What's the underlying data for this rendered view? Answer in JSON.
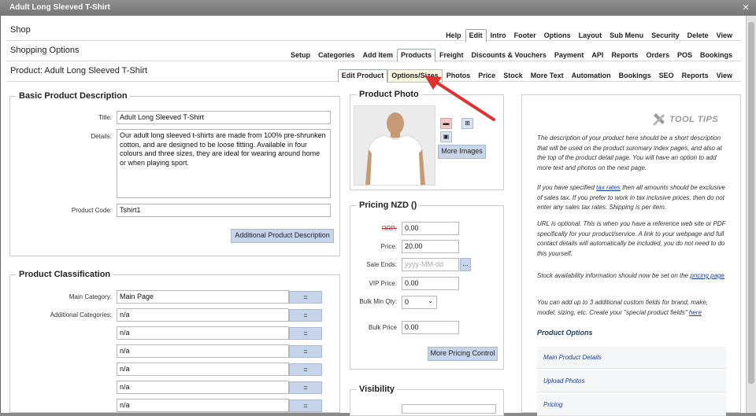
{
  "window": {
    "title": "Adult Long Sleeved T-Shirt"
  },
  "bars": {
    "shop": {
      "label": "Shop",
      "menu": [
        "Help",
        "Edit",
        "Intro",
        "Footer",
        "Options",
        "Layout",
        "Sub Menu",
        "Security",
        "Delete",
        "View"
      ]
    },
    "shopping": {
      "label": "Shopping Options",
      "menu": [
        "Setup",
        "Categories",
        "Add Item",
        "Products",
        "Freight",
        "Discounts & Vouchers",
        "Payment",
        "API",
        "Reports",
        "Orders",
        "POS",
        "Bookings"
      ]
    },
    "product": {
      "label": "Product: Adult Long Sleeved T-Shirt",
      "menu": [
        "Edit Product",
        "Options/Sizes",
        "Photos",
        "Price",
        "Stock",
        "More Text",
        "Automation",
        "Bookings",
        "SEO",
        "Reports",
        "View"
      ]
    }
  },
  "basic": {
    "legend": "Basic Product Description",
    "title_label": "Title:",
    "title_value": "Adult Long Sleeved T-Shirt",
    "details_label": "Details:",
    "details_value": "Our adult long sleeved t-shirts are made from 100% pre-shrunken cotton, and are designed to be loose fitting. Available in four colours and three sizes, they are ideal for wearing around home or when playing sport.",
    "code_label": "Product Code:",
    "code_value": "Tshirt1",
    "additional_button": "Additional Product Description"
  },
  "classification": {
    "legend": "Product Classification",
    "main_label": "Main Category:",
    "main_value": "Main Page",
    "additional_label": "Additional Categories:",
    "eq": "=",
    "additional_values": [
      "n/a",
      "n/a",
      "n/a",
      "n/a",
      "n/a",
      "n/a"
    ]
  },
  "photo": {
    "legend": "Product Photo",
    "more_images": "More Images"
  },
  "pricing": {
    "legend": "Pricing NZD ()",
    "rrp_label": "RRP:",
    "rrp_value": "0.00",
    "price_label": "Price:",
    "price_value": "20.00",
    "sale_label": "Sale Ends:",
    "sale_placeholder": "yyyy-MM-dd",
    "sale_btn": "...",
    "vip_label": "VIP Price:",
    "vip_value": "0.00",
    "bulk_min_label": "Bulk Min Qty:",
    "bulk_min_value": "0",
    "bulk_price_label": "Bulk Price",
    "bulk_price_value": "0.00",
    "more_button": "More Pricing Control"
  },
  "visibility": {
    "legend": "Visibility"
  },
  "tips": {
    "title": "TOOL TIPS",
    "p1": "The description of your product here should be a short description that will be used on the product summary index pages, and also at the top of the product detail page. You will have an option to add more text and photos on the next page.",
    "p2a": "If you have specified ",
    "p2link": "tax rates",
    "p2b": " then all amounts should be exclusive of sales tax. If you prefer to work in tax inclusive prices, then do not enter any sales tax rates. Shipping is per item.",
    "p3": "URL is optional. This is when you have a reference web site or PDF specifically for your product/service. A link to your webpage and full contact details will automatically be included, you do not need to do this yourself.",
    "p4a": "Stock availability information should now be set on the ",
    "p4link": "pricing page",
    "p5a": "You can add up to 3 additional custom fields for brand, make, model, sizing, etc. Create your \"special product fields\" ",
    "p5link": "here",
    "options_heading": "Product Options",
    "options": [
      "Main Product Details",
      "Upload Photos",
      "Pricing"
    ]
  }
}
